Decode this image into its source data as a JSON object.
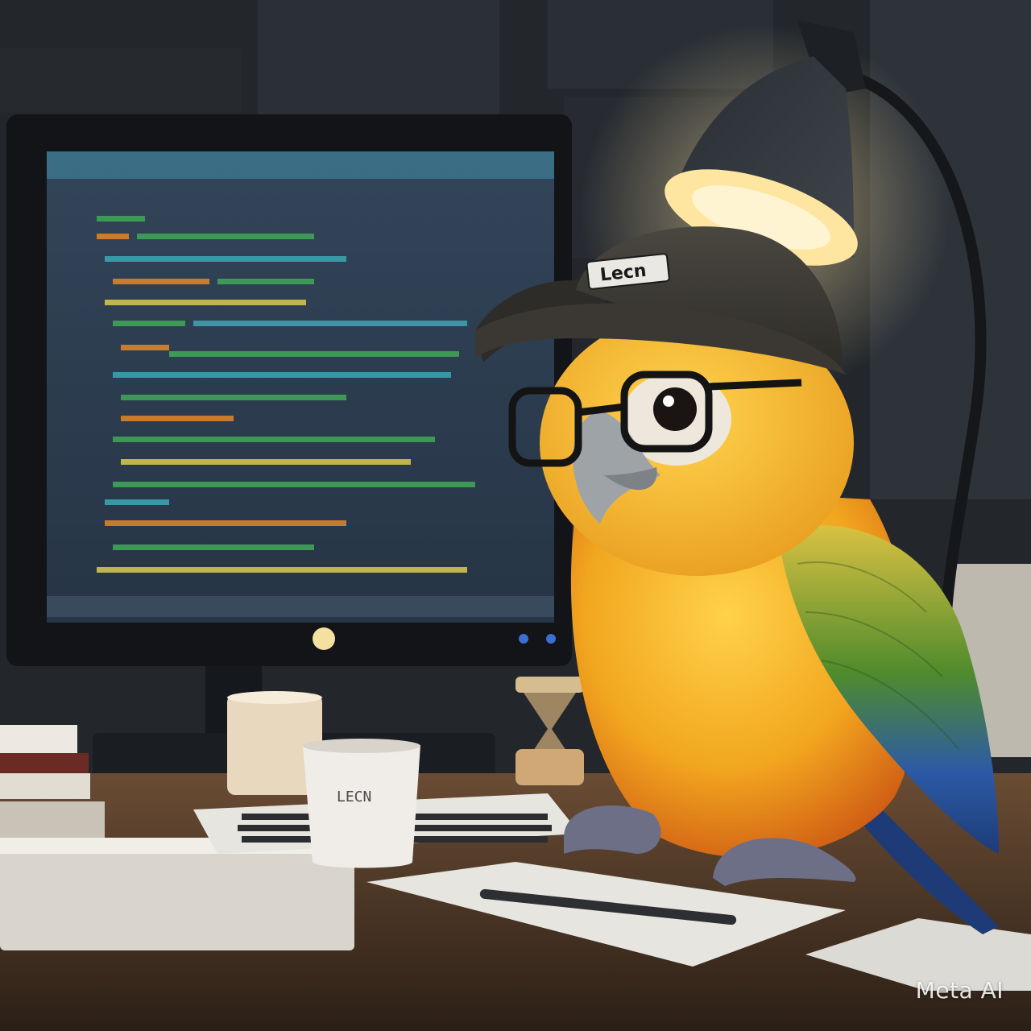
{
  "watermark": {
    "text": "Meta AI"
  },
  "cap": {
    "patch_text": "Lecn"
  },
  "mug": {
    "label": "LECN"
  },
  "palette": {
    "wall": "#23272c",
    "screen": "#2d3a4c",
    "code_green": "#3fa356",
    "code_orange": "#d9832b",
    "code_teal": "#3aa3b0",
    "code_yellow": "#d2c24a",
    "desk": "#4a3627",
    "parrot_yellow": "#f2b21f",
    "parrot_orange": "#d96a1a",
    "wing_green": "#4f8b2c",
    "wing_blue": "#2c5aa6",
    "lamp_glow": "#ffe7a6"
  },
  "icons": [
    "parrot",
    "desk-lamp",
    "monitor",
    "keyboard",
    "coffee-mug",
    "books",
    "pen",
    "hourglass"
  ]
}
